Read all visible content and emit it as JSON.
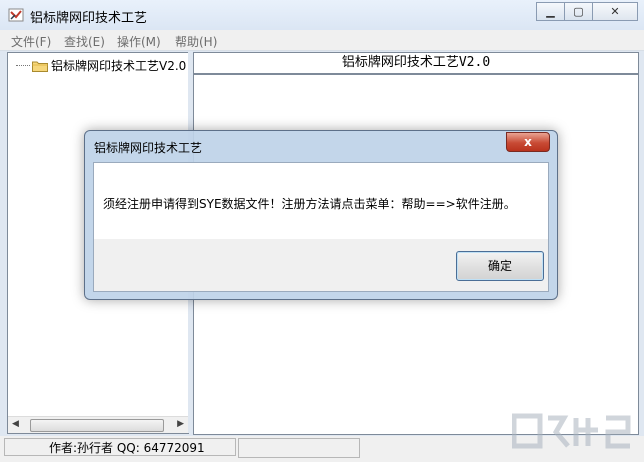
{
  "window": {
    "title": "铝标牌网印技术工艺"
  },
  "window_controls": {
    "minimize": "▁",
    "maximize": "▢",
    "close": "✕"
  },
  "menubar": [
    {
      "label": "文件(F)"
    },
    {
      "label": "查找(E)"
    },
    {
      "label": "操作(M)"
    },
    {
      "label": "帮助(H)"
    }
  ],
  "tree": {
    "items": [
      {
        "label": "铝标牌网印技术工艺V2.0"
      }
    ]
  },
  "content": {
    "header": "铝标牌网印技术工艺V2.0"
  },
  "scrollbar": {
    "left_arrow": "◀",
    "right_arrow": "▶"
  },
  "statusbar": {
    "text": "作者:孙行者 QQ: 64772091"
  },
  "dialog": {
    "title": "铝标牌网印技术工艺",
    "close_label": "x",
    "message": "须经注册申请得到SYE数据文件！注册方法请点击菜单：帮助==>软件注册。",
    "ok_label": "确定"
  },
  "colors": {
    "accent": "#5d7089",
    "close_red": "#c84b35"
  }
}
